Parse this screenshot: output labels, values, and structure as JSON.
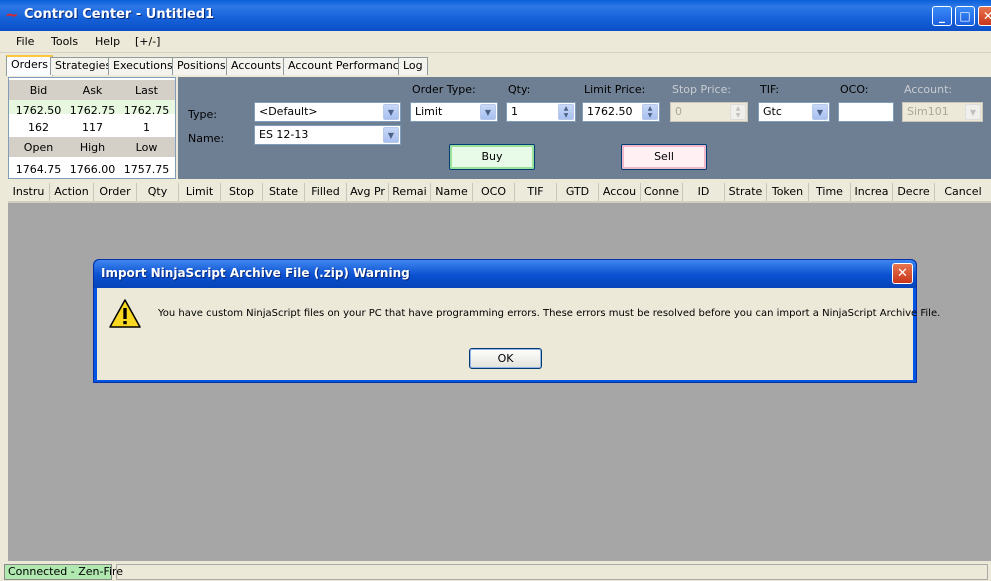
{
  "window": {
    "title": "Control Center - Untitled1"
  },
  "menu": [
    "File",
    "Tools",
    "Help",
    "[+/-]"
  ],
  "tabs": [
    "Orders",
    "Strategies",
    "Executions",
    "Positions",
    "Accounts",
    "Account Performance",
    "Log"
  ],
  "quote": {
    "headers1": [
      "Bid",
      "Ask",
      "Last"
    ],
    "row1": [
      "1762.50",
      "1762.75",
      "1762.75"
    ],
    "row2": [
      "162",
      "117",
      "1"
    ],
    "headers2": [
      "Open",
      "High",
      "Low"
    ],
    "row3": [
      "1764.75",
      "1766.00",
      "1757.75"
    ]
  },
  "entry": {
    "type_label": "Type:",
    "type_value": "<Default>",
    "name_label": "Name:",
    "name_value": "ES 12-13",
    "order_type_label": "Order Type:",
    "order_type_value": "Limit",
    "qty_label": "Qty:",
    "qty_value": "1",
    "limit_price_label": "Limit Price:",
    "limit_price_value": "1762.50",
    "stop_price_label": "Stop Price:",
    "stop_price_value": "0",
    "tif_label": "TIF:",
    "tif_value": "Gtc",
    "oco_label": "OCO:",
    "oco_value": "",
    "account_label": "Account:",
    "account_value": "Sim101",
    "buy_label": "Buy",
    "sell_label": "Sell"
  },
  "grid_columns": [
    "Instru",
    "Action",
    "Order",
    "Qty",
    "Limit",
    "Stop",
    "State",
    "Filled",
    "Avg Pr",
    "Remai",
    "Name",
    "OCO",
    "TIF",
    "GTD",
    "Accou",
    "Conne",
    "ID",
    "Strate",
    "Token",
    "Time",
    "Increa",
    "Decre",
    "Cancel"
  ],
  "status": {
    "connection": "Connected - Zen-Fire",
    "connection_color": "#b0e8b0"
  },
  "dialog": {
    "title": "Import NinjaScript Archive File (.zip) Warning",
    "message": "You have custom NinjaScript files on your PC that have programming errors. These errors must be resolved before you can import a NinjaScript Archive File.",
    "ok_label": "OK",
    "icon": "warning-icon"
  }
}
